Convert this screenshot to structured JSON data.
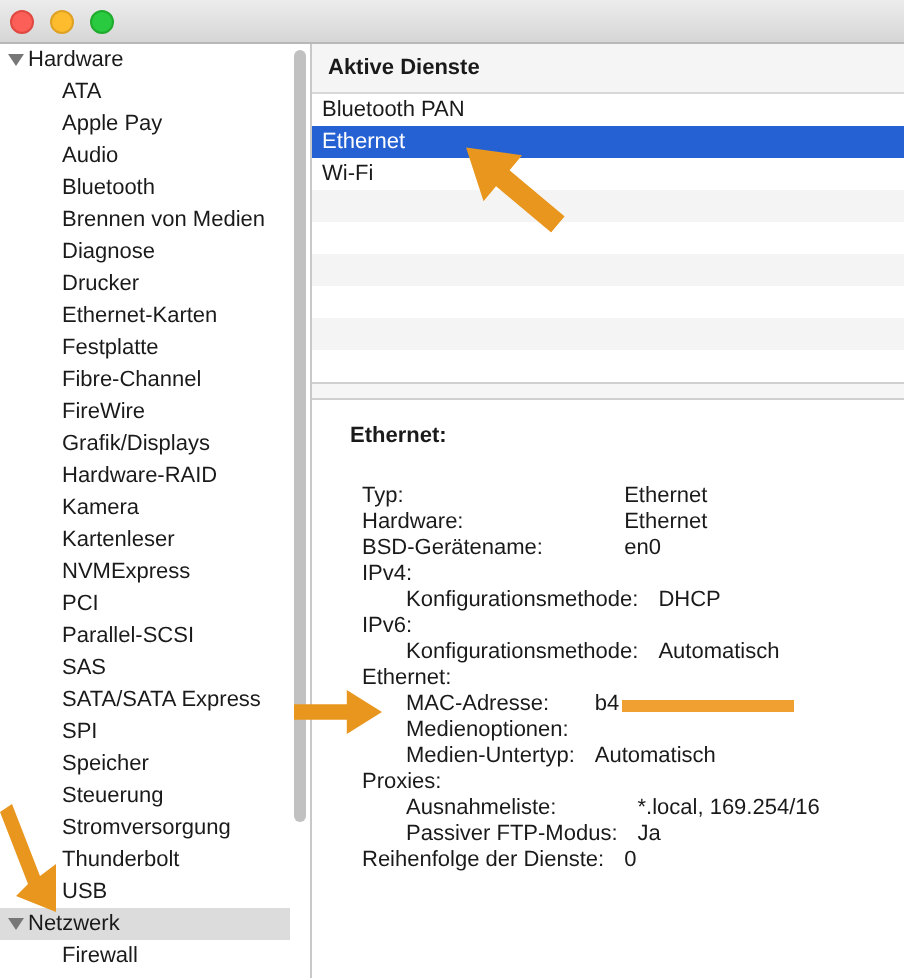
{
  "sidebar": {
    "items": [
      {
        "label": "Hardware",
        "expanded": true,
        "selected": false,
        "children": [
          {
            "label": "ATA",
            "selected": false
          },
          {
            "label": "Apple Pay",
            "selected": false
          },
          {
            "label": "Audio",
            "selected": false
          },
          {
            "label": "Bluetooth",
            "selected": false
          },
          {
            "label": "Brennen von Medien",
            "selected": false
          },
          {
            "label": "Diagnose",
            "selected": false
          },
          {
            "label": "Drucker",
            "selected": false
          },
          {
            "label": "Ethernet-Karten",
            "selected": false
          },
          {
            "label": "Festplatte",
            "selected": false
          },
          {
            "label": "Fibre-Channel",
            "selected": false
          },
          {
            "label": "FireWire",
            "selected": false
          },
          {
            "label": "Grafik/Displays",
            "selected": false
          },
          {
            "label": "Hardware-RAID",
            "selected": false
          },
          {
            "label": "Kamera",
            "selected": false
          },
          {
            "label": "Kartenleser",
            "selected": false
          },
          {
            "label": "NVMExpress",
            "selected": false
          },
          {
            "label": "PCI",
            "selected": false
          },
          {
            "label": "Parallel-SCSI",
            "selected": false
          },
          {
            "label": "SAS",
            "selected": false
          },
          {
            "label": "SATA/SATA Express",
            "selected": false
          },
          {
            "label": "SPI",
            "selected": false
          },
          {
            "label": "Speicher",
            "selected": false
          },
          {
            "label": "Steuerung",
            "selected": false
          },
          {
            "label": "Stromversorgung",
            "selected": false
          },
          {
            "label": "Thunderbolt",
            "selected": false
          },
          {
            "label": "USB",
            "selected": false
          }
        ]
      },
      {
        "label": "Netzwerk",
        "expanded": true,
        "selected": true,
        "children": [
          {
            "label": "Firewall",
            "selected": false
          }
        ]
      }
    ]
  },
  "services": {
    "column": "Aktive Dienste",
    "rows": [
      {
        "label": "Bluetooth PAN",
        "selected": false
      },
      {
        "label": "Ethernet",
        "selected": true
      },
      {
        "label": "Wi-Fi",
        "selected": false
      }
    ]
  },
  "details": {
    "title": "Ethernet:",
    "entries": [
      {
        "label": "Typ:",
        "value": "Ethernet"
      },
      {
        "label": "Hardware:",
        "value": "Ethernet"
      },
      {
        "label": "BSD-Gerätename:",
        "value": "en0"
      },
      {
        "label": "IPv4:",
        "children": [
          {
            "label": "Konfigurationsmethode:",
            "value": "DHCP"
          }
        ]
      },
      {
        "label": "IPv6:",
        "children": [
          {
            "label": "Konfigurationsmethode:",
            "value": "Automatisch"
          }
        ]
      },
      {
        "label": "Ethernet:",
        "children": [
          {
            "label": "MAC-Adresse:",
            "value": "b4",
            "redacted": true
          },
          {
            "label": "Medienoptionen:"
          },
          {
            "label": "Medien-Untertyp:",
            "value": "Automatisch"
          }
        ]
      },
      {
        "label": "Proxies:",
        "children": [
          {
            "label": "Ausnahmeliste:",
            "value": "*.local, 169.254/16"
          },
          {
            "label": "Passiver FTP-Modus:",
            "value": "Ja"
          }
        ]
      },
      {
        "label": "Reihenfolge der Dienste:",
        "value": "0"
      }
    ]
  }
}
